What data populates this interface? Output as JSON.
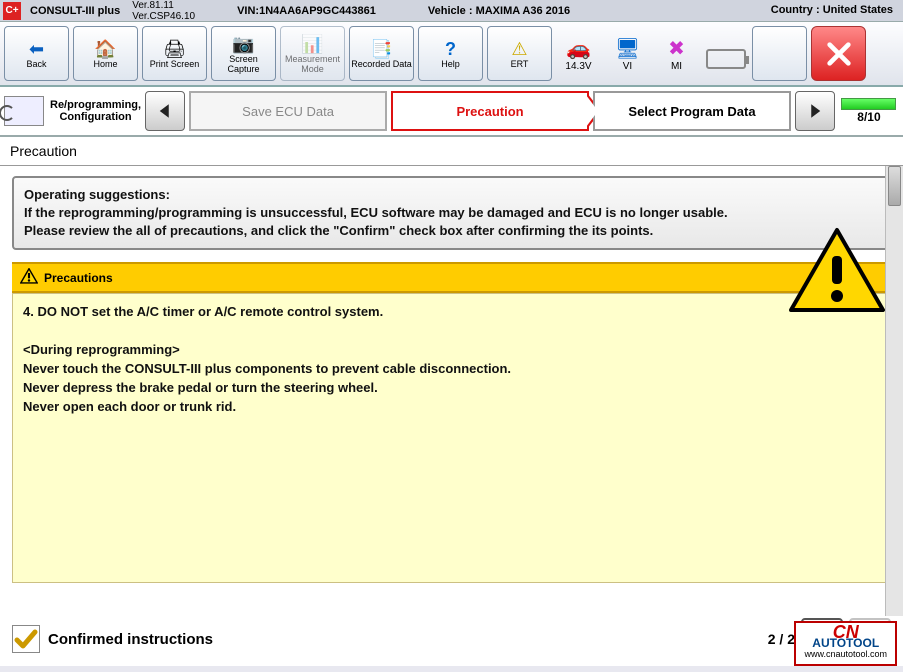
{
  "infobar": {
    "logo": "C+",
    "app_name": "CONSULT-III plus",
    "ver1": "Ver.81.11",
    "ver2": "Ver.CSP46.10",
    "vin_label": "VIN:",
    "vin": "1N4AA6AP9GC443861",
    "vehicle_label": "Vehicle :",
    "vehicle": "MAXIMA A36 2016",
    "country_label": "Country :",
    "country": "United States"
  },
  "toolbar": {
    "back": "Back",
    "home": "Home",
    "print": "Print Screen",
    "capture": "Screen Capture",
    "meas": "Measurement Mode",
    "rec": "Recorded Data",
    "help": "Help",
    "ert": "ERT",
    "voltage": "14.3V",
    "vi": "VI",
    "mi": "MI"
  },
  "steps": {
    "repro_l1": "Re/programming,",
    "repro_l2": "Configuration",
    "save": "Save ECU Data",
    "precaution": "Precaution",
    "select": "Select Program Data",
    "progress": "8/10"
  },
  "section_title": "Precaution",
  "suggestions": {
    "title": "Operating  suggestions:",
    "l1": "If the reprogramming/programming is unsuccessful, ECU software may be damaged and ECU is no longer usable.",
    "l2": "Please review the all of precautions, and click the \"Confirm\" check box after confirming the its points."
  },
  "precautions": {
    "header": "Precautions",
    "line1": "4. DO NOT set the A/C timer or A/C remote control system.",
    "line2": "<During  reprogramming>",
    "line3": "Never touch the CONSULT-III plus components to prevent cable disconnection.",
    "line4": "Never depress the brake pedal or turn the steering wheel.",
    "line5": "Never open each door or trunk rid."
  },
  "bottom": {
    "confirm": "Confirmed instructions",
    "page": "2 / 2"
  },
  "watermark": {
    "l1": "CN",
    "l2": "AUTOTOOL",
    "l3": "www.cnautotool.com"
  }
}
